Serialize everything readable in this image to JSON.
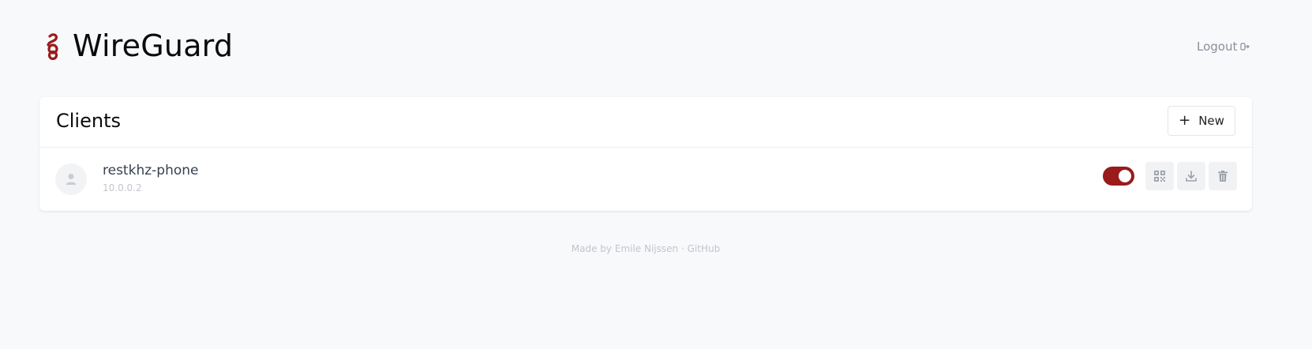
{
  "header": {
    "title": "WireGuard",
    "logout_label": "Logout",
    "brand_color": "#9b1b1b"
  },
  "clients_card": {
    "title": "Clients",
    "new_button_label": "New",
    "new_button_icon": "plus-icon"
  },
  "clients": [
    {
      "name": "restkhz-phone",
      "address": "10.0.0.2",
      "enabled": true,
      "toggle_color": "#991b1b",
      "actions": [
        "qr-code-icon",
        "download-icon",
        "trash-icon"
      ]
    }
  ],
  "footer": {
    "prefix": "Made by",
    "author": "Emile Nijssen",
    "separator": "·",
    "github": "GitHub"
  }
}
